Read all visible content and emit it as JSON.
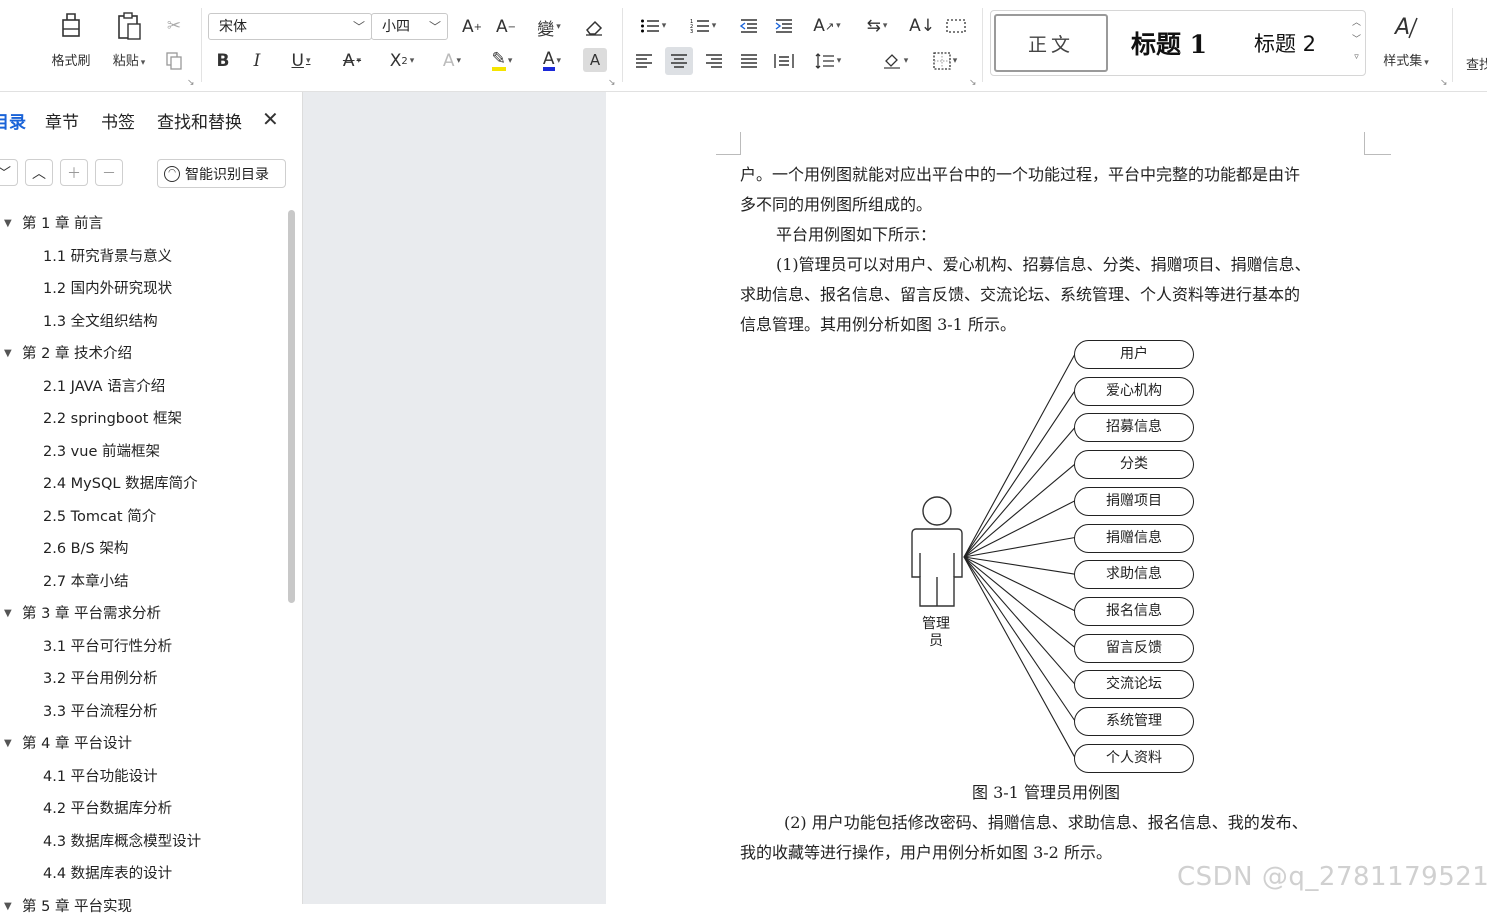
{
  "ribbon": {
    "format_painter": "格式刷",
    "paste": "粘贴",
    "font_name": "宋体",
    "font_size": "小四",
    "styles": {
      "normal": "正文",
      "heading1": "标题 1",
      "heading2": "标题 2"
    },
    "style_set": "样式集",
    "find": "查找"
  },
  "nav": {
    "tabs": [
      "目录",
      "章节",
      "书签",
      "查找和替换"
    ],
    "smart_toc": "智能识别目录",
    "toc": [
      {
        "label": "第 1 章  前言",
        "level": 1
      },
      {
        "label": "1.1 研究背景与意义",
        "level": 2
      },
      {
        "label": "1.2 国内外研究现状",
        "level": 2
      },
      {
        "label": "1.3 全文组织结构",
        "level": 2
      },
      {
        "label": "第 2 章  技术介绍",
        "level": 1
      },
      {
        "label": "2.1 JAVA 语言介绍",
        "level": 2
      },
      {
        "label": "2.2 springboot 框架",
        "level": 2
      },
      {
        "label": "2.3 vue 前端框架",
        "level": 2
      },
      {
        "label": "2.4 MySQL 数据库简介",
        "level": 2
      },
      {
        "label": "2.5 Tomcat 简介",
        "level": 2
      },
      {
        "label": "2.6 B/S 架构",
        "level": 2
      },
      {
        "label": "2.7 本章小结",
        "level": 2
      },
      {
        "label": "第 3 章  平台需求分析",
        "level": 1
      },
      {
        "label": "3.1 平台可行性分析",
        "level": 2
      },
      {
        "label": "3.2 平台用例分析",
        "level": 2
      },
      {
        "label": "3.3 平台流程分析",
        "level": 2
      },
      {
        "label": "第 4 章  平台设计",
        "level": 1
      },
      {
        "label": "4.1 平台功能设计",
        "level": 2
      },
      {
        "label": "4.2 平台数据库分析",
        "level": 2
      },
      {
        "label": "4.3 数据库概念模型设计",
        "level": 2
      },
      {
        "label": "4.4 数据库表的设计",
        "level": 2
      },
      {
        "label": "第 5 章  平台实现",
        "level": 1
      }
    ]
  },
  "document": {
    "lines": [
      "户。一个用例图就能对应出平台中的一个功能过程，平台中完整的功能都是由许",
      "多不同的用例图所组成的。",
      "平台用例图如下所示：",
      "(1)管理员可以对用户、爱心机构、招募信息、分类、捐赠项目、捐赠信息、",
      "求助信息、报名信息、留言反馈、交流论坛、系统管理、个人资料等进行基本的",
      "信息管理。其用例分析如图 3-1 所示。"
    ],
    "actor": "管理员",
    "use_cases": [
      "用户",
      "爱心机构",
      "招募信息",
      "分类",
      "捐赠项目",
      "捐赠信息",
      "求助信息",
      "报名信息",
      "留言反馈",
      "交流论坛",
      "系统管理",
      "个人资料"
    ],
    "caption": "图 3-1 管理员用例图",
    "after_lines": [
      "(2) 用户功能包括修改密码、捐赠信息、求助信息、报名信息、我的发布、",
      "我的收藏等进行操作，用户用例分析如图 3-2 所示。"
    ]
  },
  "watermark": "CSDN @q_2781179521"
}
